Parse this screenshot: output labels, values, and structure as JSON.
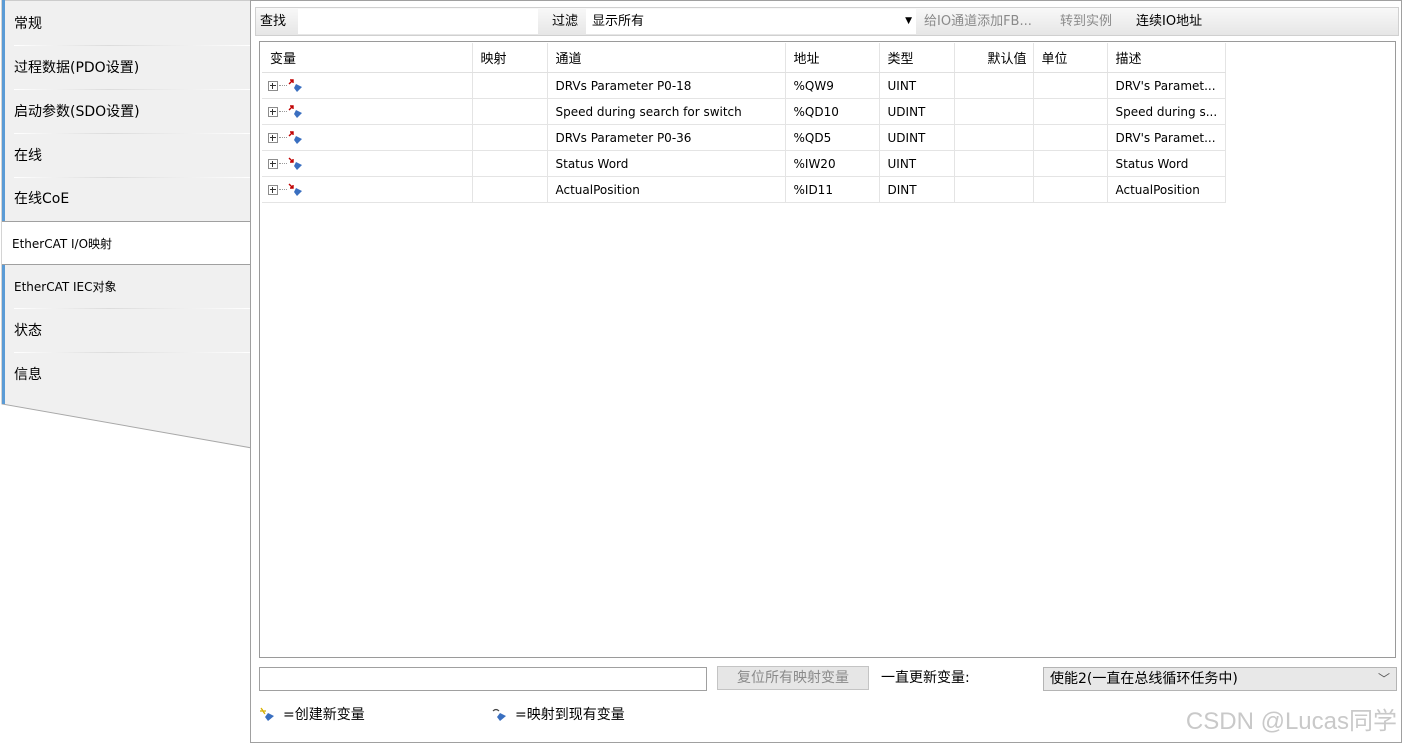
{
  "nav": {
    "items": [
      {
        "label": "常规"
      },
      {
        "label": "过程数据(PDO设置)"
      },
      {
        "label": "启动参数(SDO设置)"
      },
      {
        "label": "在线"
      },
      {
        "label": "在线CoE"
      },
      {
        "label": "EtherCAT I/O映射",
        "active": true
      },
      {
        "label": "EtherCAT IEC对象"
      },
      {
        "label": "状态"
      },
      {
        "label": "信息"
      }
    ]
  },
  "toolbar": {
    "search_label": "查找",
    "search_value": "",
    "filter_label": "过滤",
    "filter_value": "显示所有",
    "add_fb_label": "给IO通道添加FB...",
    "goto_instance_label": "转到实例",
    "continuous_io_label": "连续IO地址"
  },
  "grid": {
    "columns": [
      "变量",
      "映射",
      "通道",
      "地址",
      "类型",
      "默认值",
      "单位",
      "描述"
    ],
    "rows": [
      {
        "variable": "",
        "mapping": "",
        "channel": "DRVs Parameter  P0-18",
        "address": "%QW9",
        "type": "UINT",
        "default": "",
        "unit": "",
        "description": "DRV's Paramet...",
        "direction": "output"
      },
      {
        "variable": "",
        "mapping": "",
        "channel": "Speed during search for switch",
        "address": "%QD10",
        "type": "UDINT",
        "default": "",
        "unit": "",
        "description": "Speed during s...",
        "direction": "output"
      },
      {
        "variable": "",
        "mapping": "",
        "channel": "DRVs Parameter  P0-36",
        "address": "%QD5",
        "type": "UDINT",
        "default": "",
        "unit": "",
        "description": "DRV's Paramet...",
        "direction": "output"
      },
      {
        "variable": "",
        "mapping": "",
        "channel": "Status Word",
        "address": "%IW20",
        "type": "UINT",
        "default": "",
        "unit": "",
        "description": "Status Word",
        "direction": "input"
      },
      {
        "variable": "",
        "mapping": "",
        "channel": "ActualPosition",
        "address": "%ID11",
        "type": "DINT",
        "default": "",
        "unit": "",
        "description": "ActualPosition",
        "direction": "input"
      }
    ]
  },
  "bottom": {
    "input_value": "",
    "reset_label": "复位所有映射变量",
    "always_update_label": "一直更新变量:",
    "update_value": "使能2(一直在总线循环任务中)"
  },
  "legend": {
    "create_new": "=创建新变量",
    "map_existing": "=映射到现有变量"
  },
  "watermark": "CSDN @Lucas同学",
  "colors": {
    "nav_accent": "#5b9bd5",
    "output_arrow": "#c00000",
    "input_arrow": "#c00000",
    "icon_blue": "#3a6fc0",
    "disabled_text": "#8a8a8a"
  }
}
